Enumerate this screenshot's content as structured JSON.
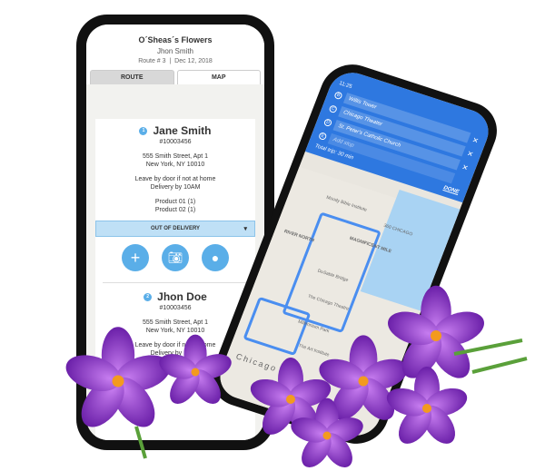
{
  "left_phone": {
    "shop": "O´Sheas´s Flowers",
    "driver": "Jhon Smith",
    "route": "Route # 3",
    "date": "Dec 12, 2018",
    "tabs": [
      "ROUTE",
      "MAP"
    ],
    "customers": [
      {
        "num": "1",
        "name": "Jane Smith",
        "id": "#10003456",
        "addr1": "555 Smith Street, Apt 1",
        "addr2": "New York, NY 10010",
        "note1": "Leave by door if not at home",
        "note2": "Delivery by 10AM",
        "p1": "Product 01 (1)",
        "p2": "Product 02 (1)"
      },
      {
        "num": "2",
        "name": "Jhon Doe",
        "id": "#10003456",
        "addr1": "555 Smith Street, Apt 1",
        "addr2": "New York, NY 10010",
        "note1": "Leave by door if not at home",
        "note2": "Delivery by 10AM"
      }
    ],
    "status_select": "OUT OF DELIVERY"
  },
  "right_phone": {
    "time": "11:25",
    "stops": [
      {
        "letter": "B",
        "name": "Willis Tower"
      },
      {
        "letter": "C",
        "name": "Chicago Theater"
      },
      {
        "letter": "D",
        "name": "St. Peter's Catholic Church"
      }
    ],
    "add_stop": "Add stop",
    "total": "Total trip: 30 min",
    "done": "DONE",
    "map_labels": [
      "360 CHICAGO",
      "MAGNIFICENT MILE",
      "RIVER NORTH",
      "DuSable Bridge",
      "The Chicago Theatre",
      "Millennium Park",
      "The Art Institute",
      "Chicago",
      "Moody Bible Institute"
    ]
  },
  "colors": {
    "accent": "#5aaee8",
    "nav_blue": "#2e78e0",
    "flower": "#8a2fc8"
  }
}
